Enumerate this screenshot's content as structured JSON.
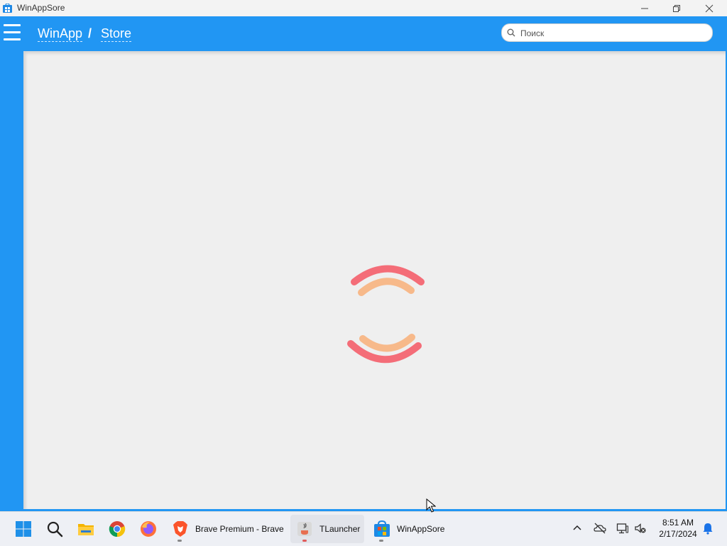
{
  "window": {
    "title": "WinAppSore",
    "icon": "store-icon",
    "controls": [
      "minimize-icon",
      "restore-icon",
      "close-icon"
    ]
  },
  "header": {
    "menu_icon": "hamburger-icon",
    "breadcrumb": {
      "root": "WinApp",
      "separator": "/",
      "current": "Store"
    },
    "search": {
      "placeholder": "Поиск",
      "value": "",
      "icon": "search-icon"
    }
  },
  "main": {
    "state": "loading",
    "spinner_colors": [
      "#f46d78",
      "#f7b98a"
    ]
  },
  "taskbar": {
    "items": [
      {
        "icon": "windows-start-icon"
      },
      {
        "icon": "search-icon"
      },
      {
        "icon": "file-explorer-icon"
      },
      {
        "icon": "chrome-icon"
      },
      {
        "icon": "firefox-icon"
      },
      {
        "icon": "brave-icon",
        "label": "Brave Premium - Brave"
      },
      {
        "icon": "tlauncher-icon",
        "label": "TLauncher"
      },
      {
        "icon": "store-icon",
        "label": "WinAppSore"
      }
    ],
    "tray": [
      "chevron-up-icon",
      "onedrive-offline-icon",
      "network-icon",
      "volume-muted-icon"
    ],
    "clock": {
      "time": "8:51 AM",
      "date": "2/17/2024"
    },
    "notification_icon": "bell-icon"
  },
  "colors": {
    "accent": "#2196f3",
    "content_bg": "#efefef"
  }
}
